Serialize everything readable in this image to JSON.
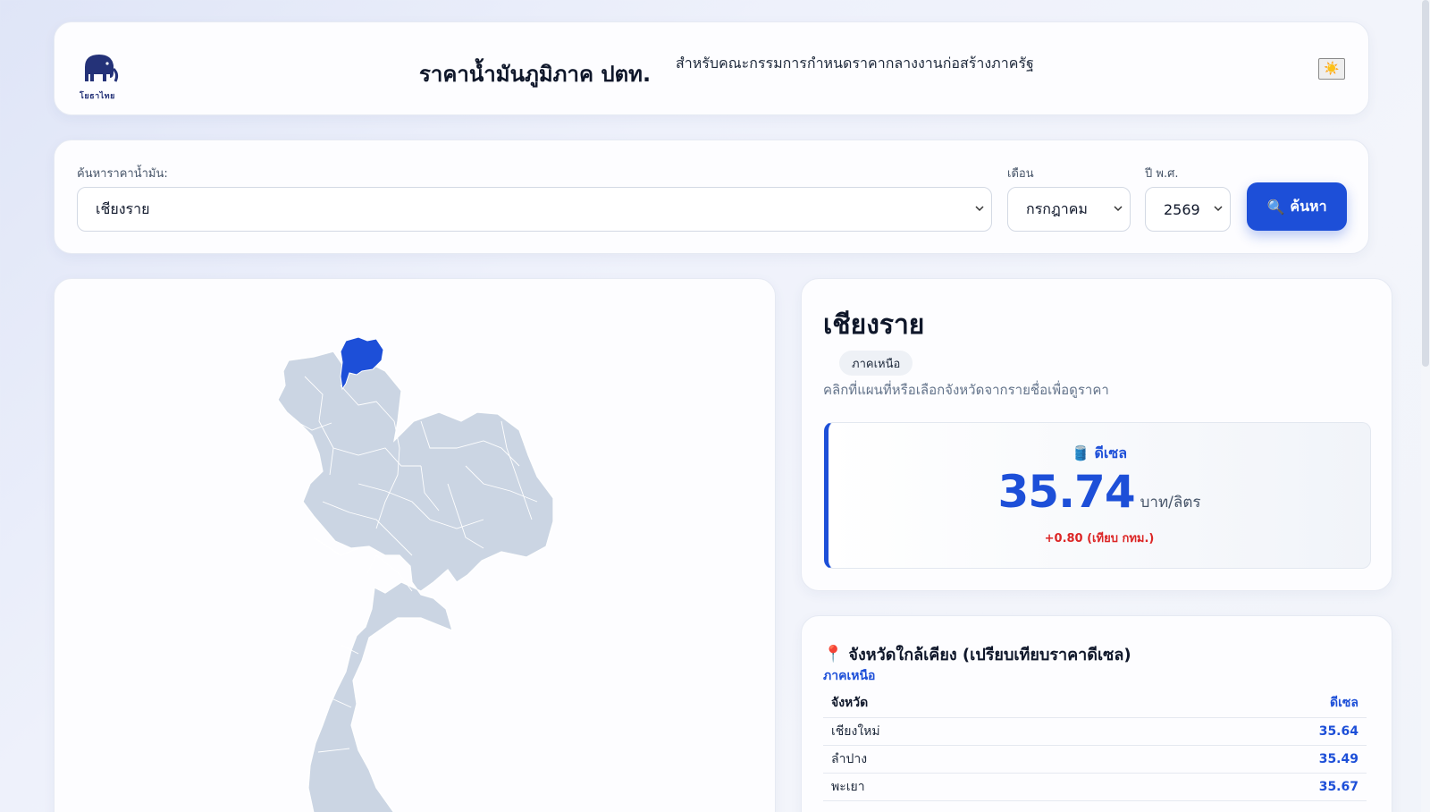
{
  "header": {
    "logo_text": "โยธาไทย",
    "title": "ราคาน้ำมันภูมิภาค ปตท.",
    "subtitle": "สำหรับคณะกรรมการกำหนดราคากลางงานก่อสร้างภาครัฐ",
    "theme_icon": "sun-icon"
  },
  "search": {
    "province_label": "ค้นหาราคาน้ำมัน:",
    "province_value": "เชียงราย",
    "month_label": "เดือน",
    "month_value": "กรกฎาคม",
    "year_label": "ปี พ.ศ.",
    "year_value": "2569",
    "button_label": "ค้นหา",
    "button_icon": "search-icon"
  },
  "info": {
    "province": "เชียงราย",
    "region": "ภาคเหนือ",
    "hint": "คลิกที่แผนที่หรือเลือกจังหวัดจากรายชื่อเพื่อดูราคา",
    "fuel_icon": "fuel-can-icon",
    "fuel_label": "ดีเซล",
    "price": "35.74",
    "unit": "บาท/ลิตร",
    "diff": "+0.80 (เทียบ กทม.)"
  },
  "nearby": {
    "title_icon": "pin-icon",
    "title": "จังหวัดใกล้เคียง (เปรียบเทียบราคาดีเซล)",
    "region": "ภาคเหนือ",
    "col_province": "จังหวัด",
    "col_price": "ดีเซล",
    "rows": [
      {
        "province": "เชียงใหม่",
        "price": "35.64"
      },
      {
        "province": "ลำปาง",
        "price": "35.49"
      },
      {
        "province": "พะเยา",
        "price": "35.67"
      }
    ]
  },
  "colors": {
    "accent": "#1d4fd8",
    "map_fill": "#cbd5e3",
    "highlight": "#1d4fd8",
    "diff_red": "#dc2626"
  }
}
